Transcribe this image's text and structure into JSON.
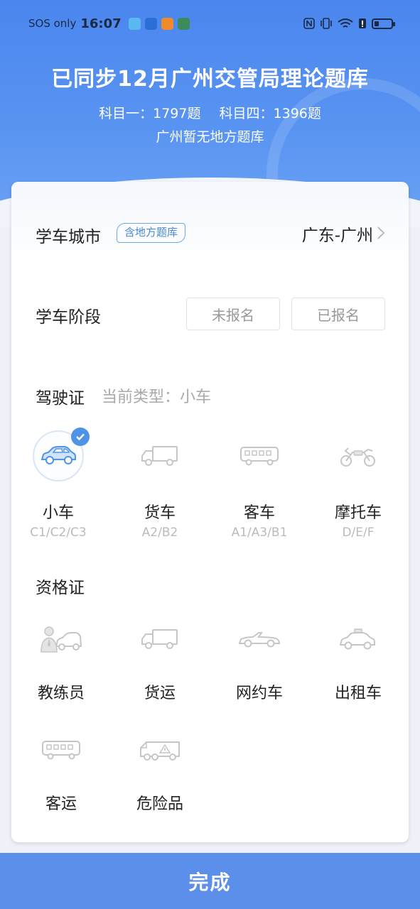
{
  "status_bar": {
    "carrier": "SOS only",
    "time": "16:07"
  },
  "header": {
    "title": "已同步12月广州交管局理论题库",
    "subject1": "科目一：1797题",
    "subject4": "科目四：1396题",
    "local_note": "广州暂无地方题库"
  },
  "city_row": {
    "label": "学车城市",
    "tag": "含地方题库",
    "value": "广东-广州"
  },
  "stage_row": {
    "label": "学车阶段",
    "options": [
      "未报名",
      "已报名"
    ]
  },
  "license": {
    "title": "驾驶证",
    "current_type": "当前类型：小车",
    "items": [
      {
        "name": "小车",
        "code": "C1/C2/C3",
        "icon": "car-icon",
        "selected": true
      },
      {
        "name": "货车",
        "code": "A2/B2",
        "icon": "truck-icon",
        "selected": false
      },
      {
        "name": "客车",
        "code": "A1/A3/B1",
        "icon": "bus-icon",
        "selected": false
      },
      {
        "name": "摩托车",
        "code": "D/E/F",
        "icon": "motorcycle-icon",
        "selected": false
      }
    ]
  },
  "qualification": {
    "title": "资格证",
    "items": [
      {
        "name": "教练员",
        "icon": "coach-icon"
      },
      {
        "name": "货运",
        "icon": "freight-truck-icon"
      },
      {
        "name": "网约车",
        "icon": "ride-hailing-car-icon"
      },
      {
        "name": "出租车",
        "icon": "taxi-icon"
      },
      {
        "name": "客运",
        "icon": "passenger-bus-icon"
      },
      {
        "name": "危险品",
        "icon": "hazmat-truck-icon"
      }
    ]
  },
  "done_button": "完成",
  "colors": {
    "header_blue": "#4a86ee",
    "accent": "#4f93e6",
    "button": "#5b8fe9"
  }
}
